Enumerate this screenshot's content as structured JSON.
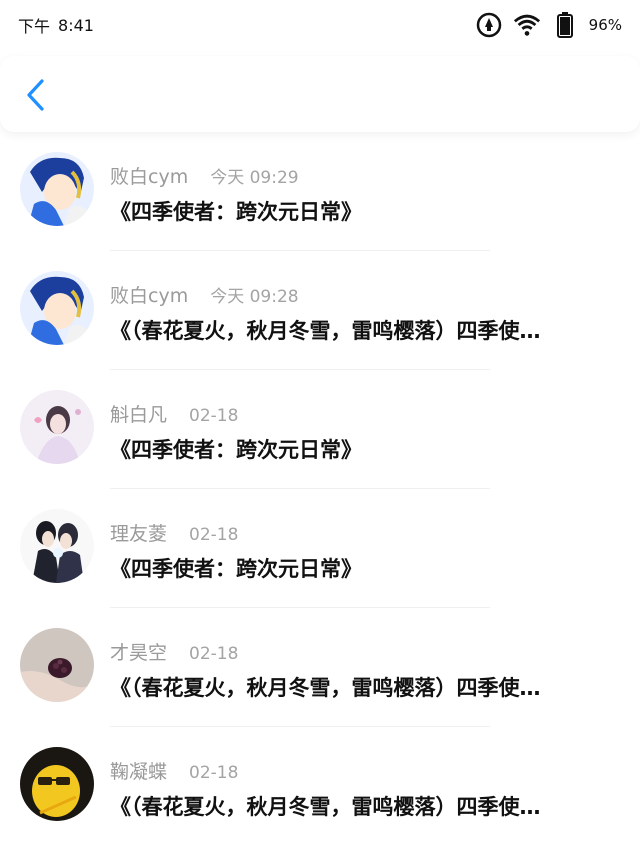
{
  "status_bar": {
    "time_prefix": "下午",
    "time": "8:41",
    "battery": "96%",
    "icons": [
      "alarm-icon",
      "wifi-icon",
      "battery-icon"
    ]
  },
  "header": {
    "back_icon": "chevron-left-icon",
    "accent_color": "#1e90ff"
  },
  "items": [
    {
      "name": "败白cym",
      "time": "今天 09:29",
      "title": "《四季使者：跨次元日常》"
    },
    {
      "name": "败白cym",
      "time": "今天 09:28",
      "title": "《（春花夏火，秋月冬雪，雷鸣樱落）四季使…"
    },
    {
      "name": "斛白凡",
      "time": "02-18",
      "title": "《四季使者：跨次元日常》"
    },
    {
      "name": "理友菱",
      "time": "02-18",
      "title": "《四季使者：跨次元日常》"
    },
    {
      "name": "才昊空",
      "time": "02-18",
      "title": "《（春花夏火，秋月冬雪，雷鸣樱落）四季使…"
    },
    {
      "name": "鞠凝蝶",
      "time": "02-18",
      "title": "《（春花夏火，秋月冬雪，雷鸣樱落）四季使…"
    }
  ]
}
